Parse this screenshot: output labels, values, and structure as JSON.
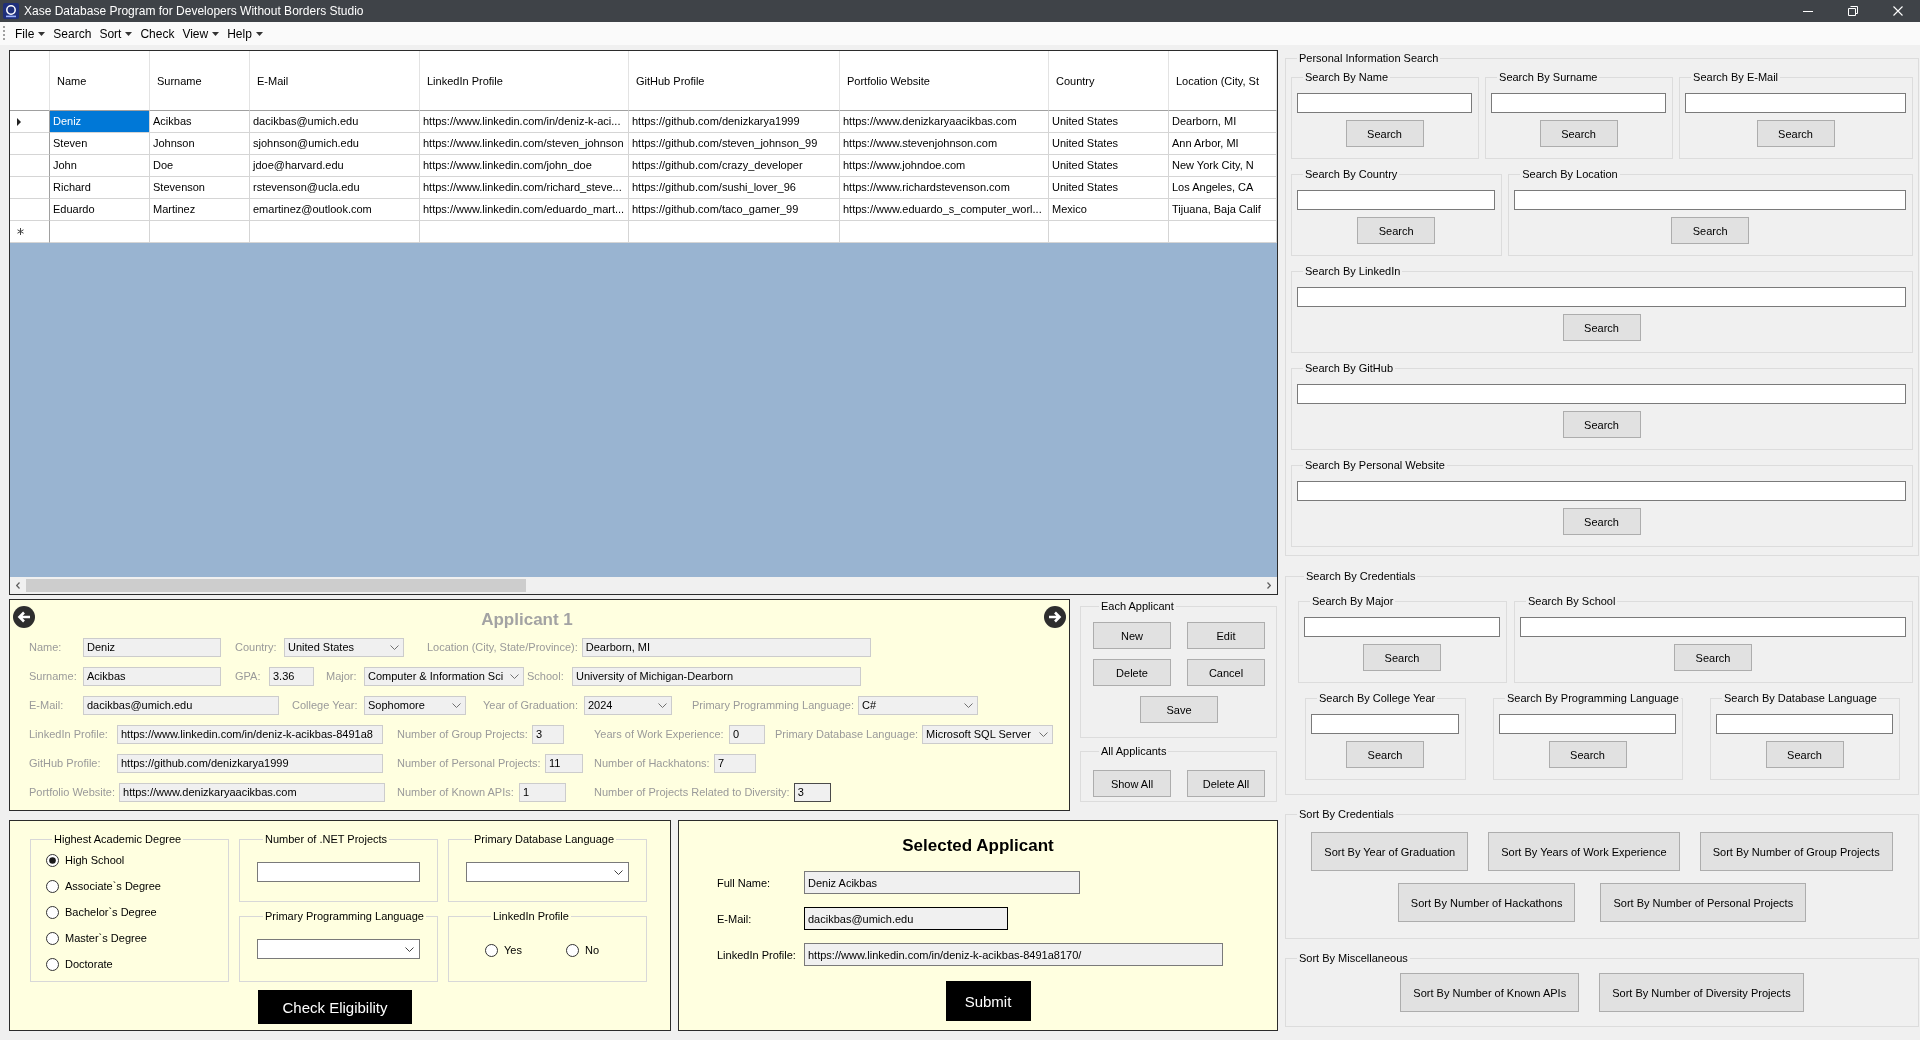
{
  "window": {
    "title": "Xase Database Program for Developers Without Borders Studio"
  },
  "menu": [
    {
      "label": "File",
      "has_submenu": true
    },
    {
      "label": "Search",
      "has_submenu": false
    },
    {
      "label": "Sort",
      "has_submenu": true
    },
    {
      "label": "Check",
      "has_submenu": false
    },
    {
      "label": "View",
      "has_submenu": true
    },
    {
      "label": "Help",
      "has_submenu": true
    }
  ],
  "table": {
    "columns": [
      "Name",
      "Surname",
      "E-Mail",
      "LinkedIn Profile",
      "GitHub Profile",
      "Portfolio Website",
      "Country",
      "Location (City, St"
    ],
    "rows": [
      {
        "selected": true,
        "cells": [
          "Deniz",
          "Acikbas",
          "dacikbas@umich.edu",
          "https://www.linkedin.com/in/deniz-k-aci...",
          "https://github.com/denizkarya1999",
          "https://www.denizkaryaacikbas.com",
          "United States",
          "Dearborn, MI"
        ]
      },
      {
        "selected": false,
        "cells": [
          "Steven",
          "Johnson",
          "sjohnson@umich.edu",
          "https://www.linkedin.com/steven_johnson",
          "https://github.com/steven_johnson_99",
          "https://www.stevenjohnson.com",
          "United States",
          "Ann Arbor, MI"
        ]
      },
      {
        "selected": false,
        "cells": [
          "John",
          "Doe",
          "jdoe@harvard.edu",
          "https://www.linkedin.com/john_doe",
          "https://github.com/crazy_developer",
          "https://www.johndoe.com",
          "United States",
          "New York City, N"
        ]
      },
      {
        "selected": false,
        "cells": [
          "Richard",
          "Stevenson",
          "rstevenson@ucla.edu",
          "https://www.linkedin.com/richard_steve...",
          "https://github.com/sushi_lover_96",
          "https://www.richardstevenson.com",
          "United States",
          "Los Angeles, CA"
        ]
      },
      {
        "selected": false,
        "cells": [
          "Eduardo",
          "Martinez",
          "emartinez@outlook.com",
          "https://www.linkedin.com/eduardo_mart...",
          "https://github.com/taco_gamer_99",
          "https://www.eduardo_s_computer_worl...",
          "Mexico",
          "Tijuana, Baja Calif"
        ]
      }
    ],
    "new_row": true
  },
  "applicant_form": {
    "title": "Applicant 1",
    "disabled": true,
    "rows": [
      {
        "fields": [
          {
            "label": "Name:",
            "value": "Deniz",
            "kind": "text",
            "focused": false
          },
          {
            "label": "Country:",
            "value": "United States",
            "kind": "combo",
            "focused": false
          },
          {
            "label": "Location (City, State/Province):",
            "value": "Dearborn, MI",
            "kind": "text",
            "focused": false
          }
        ]
      },
      {
        "fields": [
          {
            "label": "Surname:",
            "value": "Acikbas",
            "kind": "text",
            "focused": false
          },
          {
            "label": "GPA:",
            "value": "3.36",
            "kind": "text",
            "focused": false
          },
          {
            "label": "Major:",
            "value": "Computer & Information Sci",
            "kind": "combo",
            "focused": false
          },
          {
            "label": "School:",
            "value": "University of Michigan-Dearborn",
            "kind": "text",
            "focused": false
          }
        ]
      },
      {
        "fields": [
          {
            "label": "E-Mail:",
            "value": "dacikbas@umich.edu",
            "kind": "text",
            "focused": false
          },
          {
            "label": "College Year:",
            "value": "Sophomore",
            "kind": "combo",
            "focused": false
          },
          {
            "label": "Year of Graduation:",
            "value": "2024",
            "kind": "combo",
            "focused": false
          },
          {
            "label": "Primary Programming Language:",
            "value": "C#",
            "kind": "combo",
            "focused": false
          }
        ]
      },
      {
        "fields": [
          {
            "label": "LinkedIn Profile:",
            "value": "https://www.linkedin.com/in/deniz-k-acikbas-8491a8",
            "kind": "text",
            "focused": false
          },
          {
            "label": "Number of Group Projects:",
            "value": "3",
            "kind": "text",
            "focused": false
          },
          {
            "label": "Years of Work Experience:",
            "value": "0",
            "kind": "text",
            "focused": false
          },
          {
            "label": "Primary Database Language:",
            "value": "Microsoft SQL Server",
            "kind": "combo",
            "focused": false
          }
        ]
      },
      {
        "fields": [
          {
            "label": "GitHub Profile:",
            "value": "https://github.com/denizkarya1999",
            "kind": "text",
            "focused": false
          },
          {
            "label": "Number of Personal Projects:",
            "value": "11",
            "kind": "text",
            "focused": false
          },
          {
            "label": "Number of Hackhatons:",
            "value": "7",
            "kind": "text",
            "focused": false
          }
        ]
      },
      {
        "fields": [
          {
            "label": "Portfolio Website:",
            "value": "https://www.denizkaryaacikbas.com",
            "kind": "text",
            "focused": false
          },
          {
            "label": "Number of Known APIs:",
            "value": "1",
            "kind": "text",
            "focused": false
          },
          {
            "label": "Number of Projects Related to Diversity:",
            "value": "3",
            "kind": "text",
            "focused": true
          }
        ]
      }
    ]
  },
  "each_applicant": {
    "title": "Each Applicant",
    "buttons": [
      "New",
      "Edit",
      "Delete",
      "Cancel",
      "Save"
    ]
  },
  "all_applicants": {
    "title": "All Applicants",
    "buttons": [
      "Show All",
      "Delete All"
    ]
  },
  "eligibility": {
    "degree": {
      "title": "Highest Academic Degree",
      "options": [
        {
          "label": "High School",
          "selected": true
        },
        {
          "label": "Associate`s Degree",
          "selected": false
        },
        {
          "label": "Bachelor`s Degree",
          "selected": false
        },
        {
          "label": "Master`s Degree",
          "selected": false
        },
        {
          "label": "Doctorate",
          "selected": false
        }
      ]
    },
    "groups": [
      {
        "title": "Number of .NET Projects",
        "kind": "text"
      },
      {
        "title": "Primary Database Language",
        "kind": "combo"
      },
      {
        "title": "Primary Programming Language",
        "kind": "combo"
      },
      {
        "title": "LinkedIn Profile",
        "kind": "radios",
        "options": [
          {
            "label": "Yes",
            "selected": false
          },
          {
            "label": "No",
            "selected": false
          }
        ]
      }
    ],
    "button": "Check Eligibility"
  },
  "selected_applicant": {
    "title": "Selected Applicant",
    "fields": [
      {
        "label": "Full Name:",
        "value": "Deniz Acikbas",
        "focused": false
      },
      {
        "label": "E-Mail:",
        "value": "dacikbas@umich.edu",
        "focused": true
      },
      {
        "label": "LinkedIn Profile:",
        "value": "https://www.linkedin.com/in/deniz-k-acikbas-8491a8170/",
        "focused": false
      }
    ],
    "button": "Submit"
  },
  "personal_information_search": {
    "title": "Personal Information Search",
    "groups": [
      {
        "title": "Search By Name",
        "button": "Search"
      },
      {
        "title": "Search By Surname",
        "button": "Search"
      },
      {
        "title": "Search By E-Mail",
        "button": "Search"
      },
      {
        "title": "Search By Country",
        "button": "Search"
      },
      {
        "title": "Search By Location",
        "button": "Search"
      },
      {
        "title": "Search By LinkedIn",
        "button": "Search"
      },
      {
        "title": "Search By GitHub",
        "button": "Search"
      },
      {
        "title": "Search By Personal Website",
        "button": "Search"
      }
    ]
  },
  "search_by_credentials": {
    "title": "Search By Credentials",
    "groups": [
      {
        "title": "Search By Major",
        "button": "Search"
      },
      {
        "title": "Search By School",
        "button": "Search"
      },
      {
        "title": "Search By College Year",
        "button": "Search"
      },
      {
        "title": "Search By Programming Language",
        "button": "Search"
      },
      {
        "title": "Search By Database Language",
        "button": "Search"
      }
    ]
  },
  "sort_by_credentials": {
    "title": "Sort By Credentials",
    "buttons": [
      "Sort By Year of Graduation",
      "Sort By Years of Work Experience",
      "Sort By Number of Group Projects",
      "Sort By Number of Hackathons",
      "Sort By Number of Personal Projects"
    ]
  },
  "sort_by_miscellaneous": {
    "title": "Sort By Miscellaneous",
    "buttons": [
      "Sort By Number of Known APIs",
      "Sort By Number of Diversity Projects"
    ]
  }
}
